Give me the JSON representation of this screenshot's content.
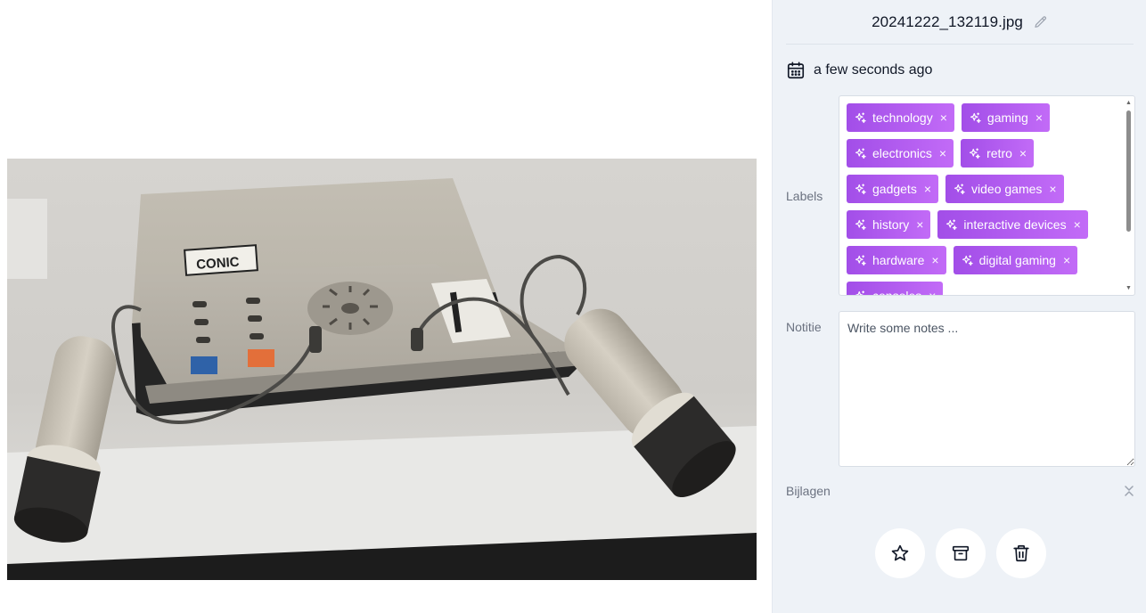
{
  "image": {
    "alt": ""
  },
  "panel": {
    "filename": "20241222_132119.jpg",
    "date": "a few seconds ago",
    "labels_label": "Labels",
    "labels": [
      "technology",
      "gaming",
      "electronics",
      "retro",
      "gadgets",
      "video games",
      "history",
      "interactive devices",
      "hardware",
      "digital gaming",
      "consoles"
    ],
    "remove_glyph": "×",
    "notes_label": "Notitie",
    "notes_placeholder": "Write some notes ...",
    "notes_value": "",
    "attachments_label": "Bijlagen"
  },
  "colors": {
    "chip_start": "#a24ee8",
    "chip_end": "#c26bf7",
    "panel_bg": "#eef2f7"
  },
  "icons": {
    "edit": "pencil-icon",
    "date": "calendar-icon",
    "label": "sparkles-icon",
    "collapse": "chevrons-up-down-icon",
    "favorite": "star-icon",
    "archive": "archive-icon",
    "delete": "trash-icon"
  }
}
